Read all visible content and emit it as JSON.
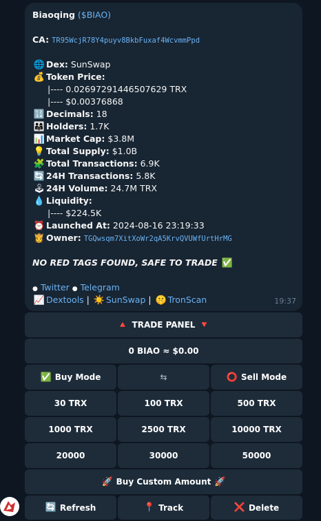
{
  "message": {
    "title": "Biaoqing",
    "ticker": "($BIAO)",
    "ca_label": "CA:",
    "ca_value": "TR95WcjR78Y4puyv8BkbFuxaf4WcvmmPpd",
    "dex_label": "Dex:",
    "dex_value": "SunSwap",
    "price_label": "Token Price:",
    "price_trx": "|---- 0.02697291446507629 TRX",
    "price_usd": "|---- $0.00376868",
    "decimals_label": "Decimals:",
    "decimals_value": "18",
    "holders_label": "Holders:",
    "holders_value": "1.7K",
    "mcap_label": "Market Cap:",
    "mcap_value": "$3.8M",
    "supply_label": "Total Supply:",
    "supply_value": "$1.0B",
    "txs_label": "Total Transactions:",
    "txs_value": "6.9K",
    "tx24_label": "24H Transactions:",
    "tx24_value": "5.8K",
    "vol24_label": "24H Volume:",
    "vol24_value": "24.7M TRX",
    "liq_label": "Liquidity:",
    "liq_value": "|---- $224.5K",
    "launched_label": "Launched At:",
    "launched_value": "2024-08-16 23:19:33",
    "owner_label": "Owner:",
    "owner_value": "TGQwsqm7XitXoWr2qA5KrvQVUWfUrtHrMG",
    "safety_note": "NO RED TAGS FOUND, SAFE TO TRADE",
    "twitter": "Twitter",
    "telegram": "Telegram",
    "dextools": "Dextools",
    "sunswap": "SunSwap",
    "tronscan": "TronScan",
    "sep": "|",
    "bullet": "●",
    "time": "19:37"
  },
  "icons": {
    "dex": "🌐",
    "price": "💰",
    "decimals": "🔢",
    "holders": "👨‍👩‍👧",
    "mcap": "📊",
    "supply": "💡",
    "txs": "🧩",
    "tx24": "🔄",
    "vol24": "🕹",
    "liq": "💧",
    "launched": "⏰",
    "owner": "👸",
    "check": "✅",
    "chart": "📈",
    "sun": "☀️",
    "coin": "🤫"
  },
  "keyboard": {
    "trade_panel": "TRADE PANEL",
    "trade_up": "🔺",
    "trade_down": "🔻",
    "balance": "0 BIAO ≈ $0.00",
    "buy_mode": "Buy Mode",
    "buy_icon": "✅",
    "swap": "⇆",
    "sell_mode": "Sell Mode",
    "sell_icon": "⭕",
    "amounts": [
      "30 TRX",
      "100 TRX",
      "500 TRX",
      "1000 TRX",
      "2500 TRX",
      "10000 TRX",
      "20000",
      "30000",
      "50000"
    ],
    "custom": "Buy Custom Amount",
    "rocket": "🚀",
    "refresh": "Refresh",
    "refresh_icon": "🔄",
    "track": "Track",
    "track_icon": "📍",
    "delete": "Delete",
    "delete_icon": "❌"
  },
  "colors": {
    "background": "#0e1621",
    "bubble": "#182533",
    "button": "#1e2c3a",
    "link": "#6ab3f3"
  }
}
